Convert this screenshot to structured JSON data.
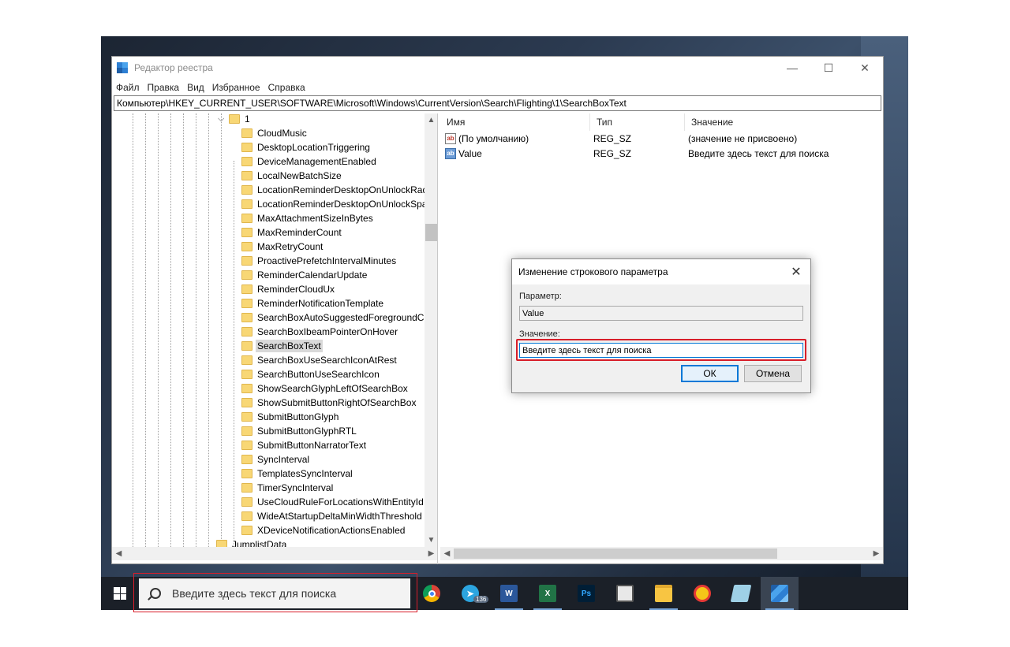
{
  "window": {
    "title": "Редактор реестра",
    "menu": [
      "Файл",
      "Правка",
      "Вид",
      "Избранное",
      "Справка"
    ],
    "address": "Компьютер\\HKEY_CURRENT_USER\\SOFTWARE\\Microsoft\\Windows\\CurrentVersion\\Search\\Flighting\\1\\SearchBoxText",
    "controls": {
      "minimize": "—",
      "maximize": "☐",
      "close": "✕"
    }
  },
  "tree": {
    "parent": "1",
    "items": [
      "CloudMusic",
      "DesktopLocationTriggering",
      "DeviceManagementEnabled",
      "LocalNewBatchSize",
      "LocationReminderDesktopOnUnlockRad",
      "LocationReminderDesktopOnUnlockSpa",
      "MaxAttachmentSizeInBytes",
      "MaxReminderCount",
      "MaxRetryCount",
      "ProactivePrefetchIntervalMinutes",
      "ReminderCalendarUpdate",
      "ReminderCloudUx",
      "ReminderNotificationTemplate",
      "SearchBoxAutoSuggestedForegroundCo",
      "SearchBoxIbeamPointerOnHover",
      "SearchBoxText",
      "SearchBoxUseSearchIconAtRest",
      "SearchButtonUseSearchIcon",
      "ShowSearchGlyphLeftOfSearchBox",
      "ShowSubmitButtonRightOfSearchBox",
      "SubmitButtonGlyph",
      "SubmitButtonGlyphRTL",
      "SubmitButtonNarratorText",
      "SyncInterval",
      "TemplatesSyncInterval",
      "TimerSyncInterval",
      "UseCloudRuleForLocationsWithEntityId",
      "WideAtStartupDeltaMinWidthThreshold",
      "XDeviceNotificationActionsEnabled"
    ],
    "selected": "SearchBoxText",
    "next_sibling": "JumplistData"
  },
  "values": {
    "headers": {
      "name": "Имя",
      "type": "Тип",
      "data": "Значение"
    },
    "rows": [
      {
        "icon": "ab",
        "name": "(По умолчанию)",
        "type": "REG_SZ",
        "data": "(значение не присвоено)"
      },
      {
        "icon": "ab",
        "name": "Value",
        "type": "REG_SZ",
        "data": "Введите здесь текст для поиска"
      }
    ]
  },
  "dialog": {
    "title": "Изменение строкового параметра",
    "param_label": "Параметр:",
    "param_value": "Value",
    "value_label": "Значение:",
    "value_text": "Введите здесь текст для поиска",
    "ok_label": "ОК",
    "cancel_label": "Отмена",
    "close_glyph": "✕"
  },
  "taskbar": {
    "search_placeholder": "Введите здесь текст для поиска",
    "telegram_badge": "136",
    "word_label": "W",
    "excel_label": "X",
    "ps_label": "Ps"
  },
  "colors": {
    "highlight_red": "#d81e2a",
    "accent": "#0078d7",
    "taskbar": "#1b2028"
  }
}
